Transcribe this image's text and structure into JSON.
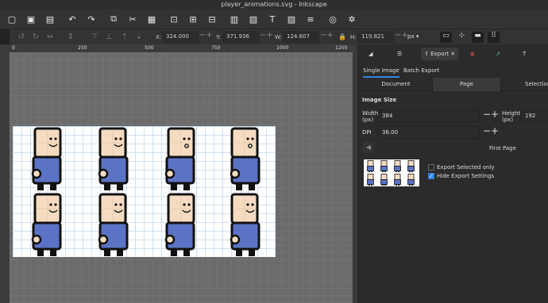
{
  "window": {
    "title": "player_animations.svg - Inkscape"
  },
  "toolbar": {
    "icons": [
      "new-document-icon",
      "open-file-icon",
      "save-icon",
      "undo-icon",
      "redo-icon",
      "copy-icon",
      "cut-icon",
      "paste-icon",
      "zoom-selection-icon",
      "zoom-drawing-icon",
      "zoom-page-icon",
      "group-icon",
      "ungroup-icon",
      "text-tool-icon",
      "image-icon",
      "align-icon",
      "xml-editor-icon",
      "preferences-icon"
    ]
  },
  "controls": {
    "x_label": "X:",
    "x_value": "324.000",
    "y_label": "Y:",
    "y_value": "371.936",
    "w_label": "W:",
    "w_value": "124.607",
    "h_label": "H:",
    "h_value": "119.821",
    "unit": "px"
  },
  "ruler": {
    "ticks": [
      "0",
      "250",
      "500",
      "750",
      "1000",
      "1250"
    ]
  },
  "dock": {
    "tabs": [
      "Export"
    ],
    "export_tab_label": "Export",
    "close_glyph": "✕",
    "subtabs": [
      "Single Image",
      "Batch Export"
    ],
    "areas": [
      "Document",
      "Page",
      "Selection"
    ],
    "image_size_title": "Image Size",
    "width_label": "Width\n(px)",
    "width_value": "384",
    "height_label": "Height\n(px)",
    "height_value": "192",
    "dpi_label": "DPI",
    "dpi_value": "36.00",
    "page_nav_label": "First Page",
    "export_selected_only": "Export Selected only",
    "hide_export_settings": "Hide Export Settings",
    "hide_export_checked": true
  },
  "colors": {
    "accent": "#3584e4",
    "body": "#5b73c4",
    "face": "#f5dcc0",
    "outline": "#111111"
  }
}
